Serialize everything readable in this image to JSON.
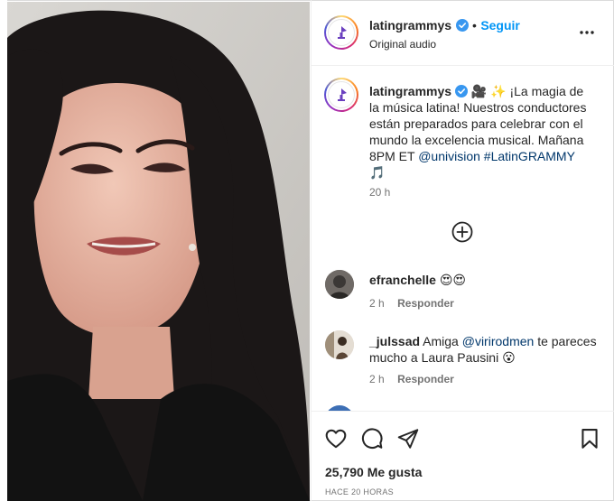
{
  "post": {
    "author": {
      "username": "latingrammys",
      "subtitle": "Original audio",
      "follow_label": "Seguir",
      "separator": "•"
    },
    "caption": {
      "username": "latingrammys",
      "emojis_lead": "🎥 ✨",
      "text": "¡La magia de la música latina! Nuestros conductores están preparados para celebrar con el mundo la excelencia musical. Mañana 8PM ET",
      "mention": "@univision",
      "hashtag": "#LatinGRAMMY",
      "emoji_tail": "🎵",
      "time": "20 h"
    },
    "comments": [
      {
        "username": "efranchelle",
        "text": "😍😍",
        "time": "2 h",
        "reply_label": "Responder"
      },
      {
        "username": "_julssad",
        "text_before": "Amiga",
        "mention": "@virirodmen",
        "text_after": "te pareces mucho a Laura Pausini 😮",
        "time": "2 h",
        "reply_label": "Responder"
      }
    ],
    "likes_count": "25,790",
    "likes_label": "Me gusta",
    "time_ago": "HACE 20 HORAS"
  },
  "icons": {
    "verified": "verified-badge-icon",
    "more": "more-options-icon",
    "load_more": "add-circle-icon",
    "like": "heart-icon",
    "comment": "comment-icon",
    "share": "share-icon",
    "save": "bookmark-icon"
  },
  "colors": {
    "accent": "#0095f6",
    "link": "#00376b",
    "verified": "#3897f0",
    "muted": "#737373"
  }
}
